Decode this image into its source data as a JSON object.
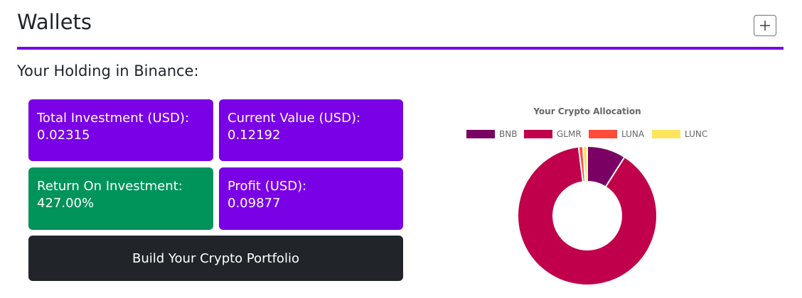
{
  "header": {
    "title": "Wallets"
  },
  "holding": {
    "title": "Your Holding in Binance:"
  },
  "cards": {
    "total_investment": {
      "label": "Total Investment (USD):",
      "value": "0.02315"
    },
    "current_value": {
      "label": "Current Value (USD):",
      "value": "0.12192"
    },
    "roi": {
      "label": "Return On Investment:",
      "value": "427.00%"
    },
    "profit": {
      "label": "Profit (USD):",
      "value": "0.09877"
    }
  },
  "build_button": {
    "label": "Build Your Crypto Portfolio"
  },
  "colors": {
    "accent": "#7a00e6",
    "roi_green": "#00935a",
    "button_dark": "#212529"
  },
  "chart_data": {
    "type": "pie",
    "title": "Your Crypto Allocation",
    "legend_position": "top",
    "categories": [
      "BNB",
      "GLMR",
      "LUNA",
      "LUNC"
    ],
    "values": [
      0.09,
      0.89,
      0.01,
      0.01
    ],
    "colors": [
      "#7a0063",
      "#c0004a",
      "#ff4b3a",
      "#ffe45c"
    ]
  }
}
